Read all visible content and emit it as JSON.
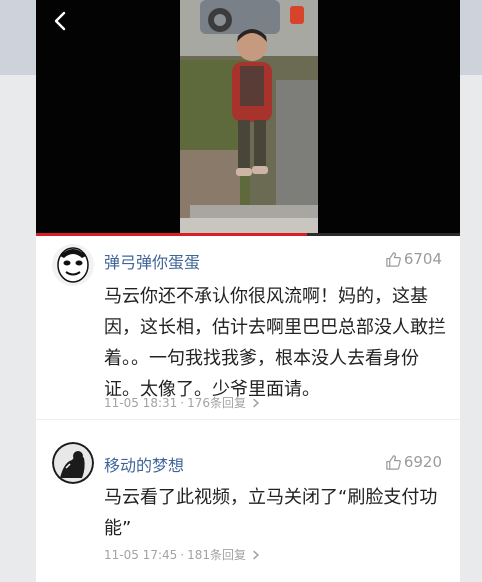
{
  "colors": {
    "username": "#406599",
    "progress": "#d61f26",
    "meta": "#a3a3a3"
  },
  "video": {
    "progress_fraction": 0.64
  },
  "comments": [
    {
      "username": "弹弓弹你蛋蛋",
      "likes": "6704",
      "text": "马云你还不承认你很风流啊！妈的，这基因，这长相，估计去啊里巴巴总部没人敢拦着。。一句我找我爹，根本没人去看身份证。太像了。少爷里面请。",
      "time": "11-05 18:31",
      "separator": "·",
      "replies": "176条回复"
    },
    {
      "username": "移动的梦想",
      "likes": "6920",
      "text": "马云看了此视频，立马关闭了“刷脸支付功能”",
      "time": "11-05 17:45",
      "separator": "·",
      "replies": "181条回复"
    }
  ]
}
